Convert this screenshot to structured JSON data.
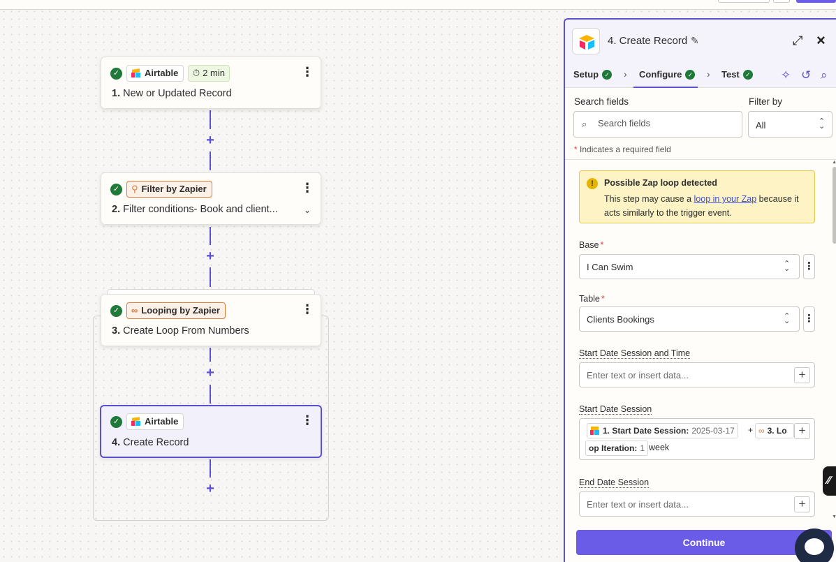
{
  "canvas": {
    "steps": [
      {
        "app": "Airtable",
        "duration": "2 min",
        "number": "1.",
        "title": "New or Updated Record"
      },
      {
        "app": "Filter by Zapier",
        "number": "2.",
        "title": "Filter conditions- Book and client..."
      },
      {
        "app": "Looping by Zapier",
        "number": "3.",
        "title": "Create Loop From Numbers"
      },
      {
        "app": "Airtable",
        "number": "4.",
        "title": "Create Record"
      }
    ]
  },
  "panel": {
    "title": "4. Create Record",
    "tabs": [
      {
        "label": "Setup"
      },
      {
        "label": "Configure"
      },
      {
        "label": "Test"
      }
    ],
    "search": {
      "label": "Search fields",
      "placeholder": "Search fields"
    },
    "filter": {
      "label": "Filter by",
      "value": "All"
    },
    "required_note": "Indicates a required field",
    "required_star": "*",
    "warning": {
      "title": "Possible Zap loop detected",
      "text_before": "This step may cause a ",
      "link": "loop in your Zap",
      "text_after": " because it acts similarly to the trigger event."
    },
    "fields": {
      "base": {
        "label": "Base",
        "value": "I Can Swim"
      },
      "table": {
        "label": "Table",
        "value": "Clients Bookings"
      },
      "start_date_time": {
        "label": "Start Date Session and Time",
        "placeholder": "Enter text or insert data..."
      },
      "start_date": {
        "label": "Start Date Session",
        "chip1_label": "1. Start Date Session:",
        "chip1_value": "2025-03-17",
        "plus_sep": "+",
        "chip2_label_a": "3. Lo",
        "chip2_label_b": "op Iteration:",
        "chip2_value": "1",
        "suffix": "week"
      },
      "end_date": {
        "label": "End Date Session",
        "placeholder": "Enter text or insert data..."
      }
    },
    "continue_label": "Continue"
  },
  "colors": {
    "accent": "#5a4fcf",
    "button": "#6b5ce7",
    "success": "#1f7a3a",
    "warning_bg": "#fdf3c5"
  }
}
